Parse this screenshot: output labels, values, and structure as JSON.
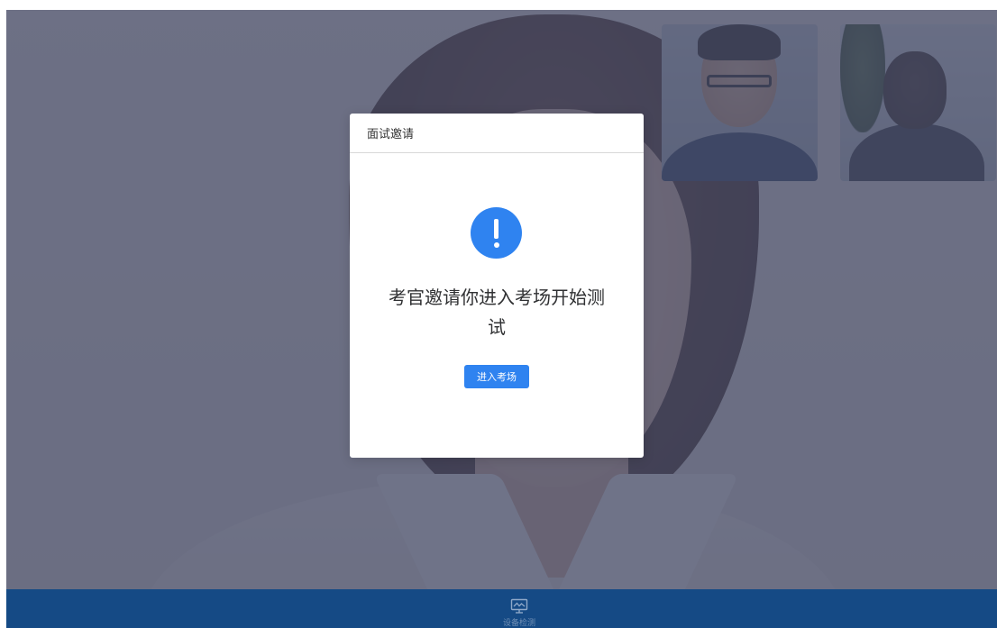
{
  "dialog": {
    "title": "面试邀请",
    "message": "考官邀请你进入考场开始测试",
    "button_label": "进入考场",
    "icon": "exclamation-icon",
    "accent_color": "#2f83f0"
  },
  "toolbar": {
    "device_check_label": "设备检测",
    "device_check_icon": "monitor-icon",
    "background_color": "#154a85"
  },
  "videos": {
    "main": "candidate-video",
    "thumbnails": [
      "examiner-video-1",
      "examiner-video-2"
    ]
  }
}
